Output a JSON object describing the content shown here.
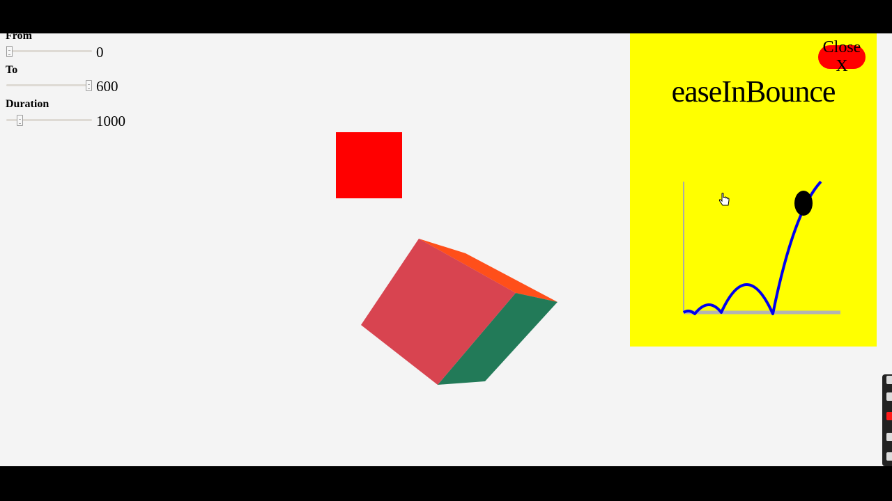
{
  "controls": {
    "from": {
      "label": "From",
      "value": "0",
      "slider_fraction": 0.0
    },
    "to": {
      "label": "To",
      "value": "600",
      "slider_fraction": 1.0
    },
    "duration": {
      "label": "Duration",
      "value": "1000",
      "slider_fraction": 0.13
    }
  },
  "panel": {
    "title": "easeInBounce",
    "close_label": "Close X"
  },
  "colors": {
    "background": "#f4f4f4",
    "panel": "#ffff00",
    "close_button": "#ff0000",
    "square": "#ff0000",
    "curve": "#0000ee",
    "cube_front": "#d84450",
    "cube_side": "#227a58",
    "cube_top": "#ff4f1a"
  },
  "icons": {
    "cursor": "hand-pointer-icon",
    "ball": "easing-ball-icon"
  }
}
